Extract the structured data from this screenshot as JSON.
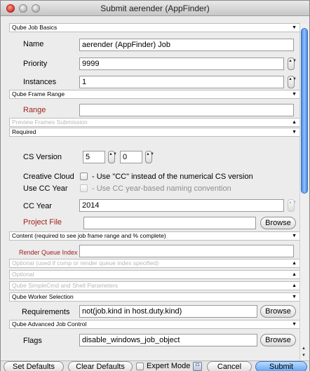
{
  "window": {
    "title": "Submit aerender (AppFinder)"
  },
  "sections": {
    "basics": "Qube Job Basics",
    "frame_range": "Qube Frame Range",
    "preview": "Preview Frames Submission",
    "required": "Required",
    "content": "Content (required to see job frame range and % complete)",
    "optional_used": "Optional (used if comp or render queue index specified)",
    "optional": "Optional",
    "simplecmd": "Qube SimpleCmd and Shell Parameters",
    "worker": "Qube Worker Selection",
    "advanced": "Qube Advanced Job Control"
  },
  "arrows": {
    "down": "▼",
    "up": "▲"
  },
  "stepper_glyph": "▲▼",
  "basics": {
    "name_label": "Name",
    "name_value": "aerender (AppFinder) Job",
    "priority_label": "Priority",
    "priority_value": "9999",
    "instances_label": "Instances",
    "instances_value": "1"
  },
  "frame_range": {
    "range_label": "Range",
    "range_value": ""
  },
  "required": {
    "cs_version_label": "CS Version",
    "cs_major": "5",
    "cs_minor": "0",
    "creative_cloud_label": "Creative Cloud",
    "creative_cloud_hint": "- Use \"CC\" instead of the numerical CS version",
    "use_cc_year_label": "Use CC Year",
    "use_cc_year_hint": "- Use CC year-based naming convention",
    "cc_year_label": "CC Year",
    "cc_year_value": "2014",
    "project_file_label": "Project File",
    "project_file_value": "",
    "browse_label": "Browse"
  },
  "content": {
    "rq_index_label": "Render Queue Index",
    "rq_index_value": ""
  },
  "worker": {
    "requirements_label": "Requirements",
    "requirements_value": "not(job.kind in host.duty.kind)",
    "browse_label": "Browse"
  },
  "advanced": {
    "flags_label": "Flags",
    "flags_value": "disable_windows_job_object",
    "browse_label": "Browse"
  },
  "footer": {
    "set_defaults": "Set Defaults",
    "clear_defaults": "Clear Defaults",
    "expert_mode": "Expert Mode",
    "cancel": "Cancel",
    "submit": "Submit"
  }
}
